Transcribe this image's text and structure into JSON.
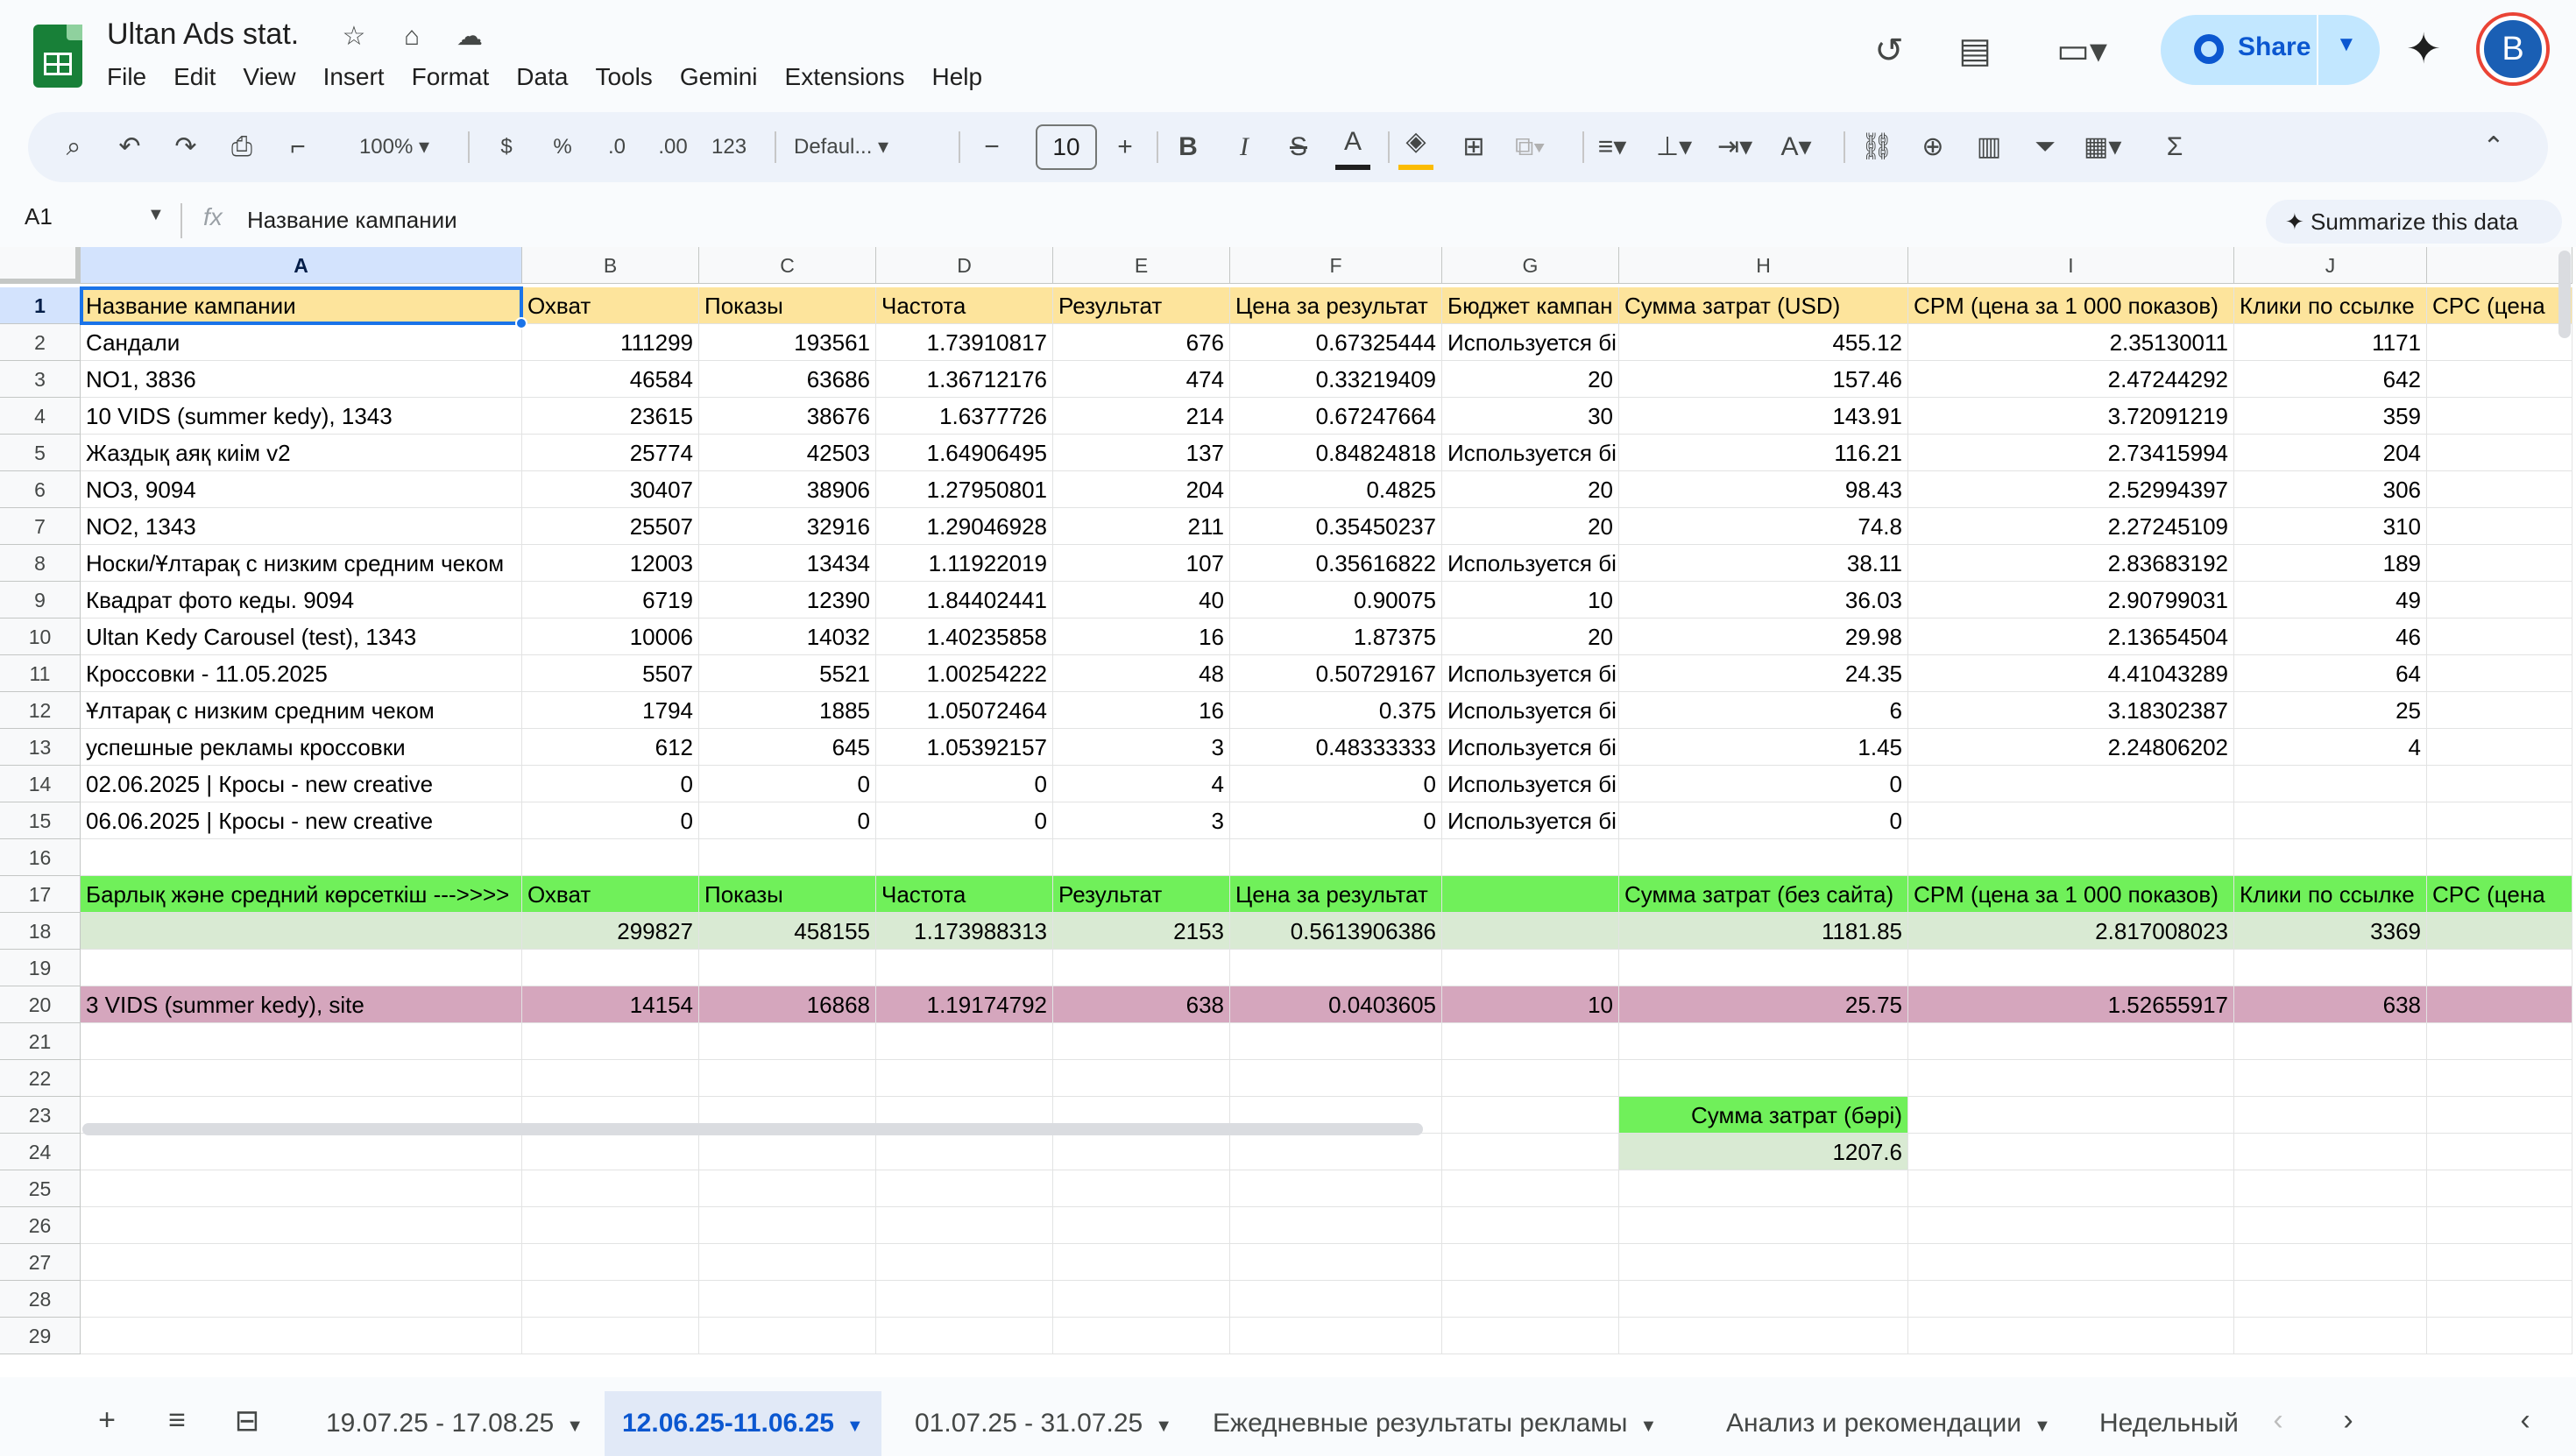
{
  "doc_title": "Ultan Ads stat.",
  "menu": [
    "File",
    "Edit",
    "View",
    "Insert",
    "Format",
    "Data",
    "Tools",
    "Gemini",
    "Extensions",
    "Help"
  ],
  "share_label": "Share",
  "avatar_letter": "B",
  "toolbar": {
    "zoom": "100%",
    "currency": "$",
    "percent": "%",
    "dec_decrease": ".0",
    "dec_increase": ".00",
    "num_format": "123",
    "font": "Defaul...",
    "font_size": "10"
  },
  "name_box": "A1",
  "formula": "Название кампании",
  "summarize_label": "Summarize this data",
  "columns": [
    "A",
    "B",
    "C",
    "D",
    "E",
    "F",
    "G",
    "H",
    "I",
    "J",
    ""
  ],
  "rows": [
    [
      "Название кампании",
      "Охват",
      "Показы",
      "Частота",
      "Результат",
      "Цена за результат",
      "Бюджет кампан",
      "Сумма затрат (USD)",
      "CPM (цена за 1 000 показов)",
      "Клики по ссылке",
      "CPC (цена"
    ],
    [
      "Сандали",
      "111299",
      "193561",
      "1.73910817",
      "676",
      "0.67325444",
      "Используется бі",
      "455.12",
      "2.35130011",
      "1171",
      ""
    ],
    [
      "NO1, 3836",
      "46584",
      "63686",
      "1.36712176",
      "474",
      "0.33219409",
      "20",
      "157.46",
      "2.47244292",
      "642",
      ""
    ],
    [
      "10 VIDS (summer kedy), 1343",
      "23615",
      "38676",
      "1.6377726",
      "214",
      "0.67247664",
      "30",
      "143.91",
      "3.72091219",
      "359",
      ""
    ],
    [
      "Жаздық аяқ киім v2",
      "25774",
      "42503",
      "1.64906495",
      "137",
      "0.84824818",
      "Используется бі",
      "116.21",
      "2.73415994",
      "204",
      ""
    ],
    [
      "NO3, 9094",
      "30407",
      "38906",
      "1.27950801",
      "204",
      "0.4825",
      "20",
      "98.43",
      "2.52994397",
      "306",
      ""
    ],
    [
      "NO2, 1343",
      "25507",
      "32916",
      "1.29046928",
      "211",
      "0.35450237",
      "20",
      "74.8",
      "2.27245109",
      "310",
      ""
    ],
    [
      "Носки/Ұлтарақ с низким средним чеком",
      "12003",
      "13434",
      "1.11922019",
      "107",
      "0.35616822",
      "Используется бі",
      "38.11",
      "2.83683192",
      "189",
      ""
    ],
    [
      "Квадрат фото кеды. 9094",
      "6719",
      "12390",
      "1.84402441",
      "40",
      "0.90075",
      "10",
      "36.03",
      "2.90799031",
      "49",
      ""
    ],
    [
      "Ultan Kedy Carousel (test), 1343",
      "10006",
      "14032",
      "1.40235858",
      "16",
      "1.87375",
      "20",
      "29.98",
      "2.13654504",
      "46",
      ""
    ],
    [
      "Кроссовки - 11.05.2025",
      "5507",
      "5521",
      "1.00254222",
      "48",
      "0.50729167",
      "Используется бі",
      "24.35",
      "4.41043289",
      "64",
      ""
    ],
    [
      "Ұлтарақ с низким средним чеком",
      "1794",
      "1885",
      "1.05072464",
      "16",
      "0.375",
      "Используется бі",
      "6",
      "3.18302387",
      "25",
      ""
    ],
    [
      "успешные рекламы кроссовки",
      "612",
      "645",
      "1.05392157",
      "3",
      "0.48333333",
      "Используется бі",
      "1.45",
      "2.24806202",
      "4",
      ""
    ],
    [
      "02.06.2025 | Кросы - new creative",
      "0",
      "0",
      "0",
      "4",
      "0",
      "Используется бі",
      "0",
      "",
      "",
      ""
    ],
    [
      "06.06.2025 | Кросы - new creative",
      "0",
      "0",
      "0",
      "3",
      "0",
      "Используется бі",
      "0",
      "",
      "",
      ""
    ],
    [
      "",
      "",
      "",
      "",
      "",
      "",
      "",
      "",
      "",
      "",
      ""
    ],
    [
      "Барлық және средний көрсеткіш --->>>>",
      "Охват",
      "Показы",
      "Частота",
      "Результат",
      "Цена за результат",
      "",
      "Сумма затрат (без сайта)",
      "CPM (цена за 1 000 показов)",
      "Клики по ссылке",
      "CPC (цена"
    ],
    [
      "",
      "299827",
      "458155",
      "1.173988313",
      "2153",
      "0.5613906386",
      "",
      "1181.85",
      "2.817008023",
      "3369",
      ""
    ],
    [
      "",
      "",
      "",
      "",
      "",
      "",
      "",
      "",
      "",
      "",
      ""
    ],
    [
      "3 VIDS (summer kedy), site",
      "14154",
      "16868",
      "1.19174792",
      "638",
      "0.0403605",
      "10",
      "25.75",
      "1.52655917",
      "638",
      ""
    ],
    [
      "",
      "",
      "",
      "",
      "",
      "",
      "",
      "",
      "",
      "",
      ""
    ],
    [
      "",
      "",
      "",
      "",
      "",
      "",
      "",
      "",
      "",
      "",
      ""
    ],
    [
      "",
      "",
      "",
      "",
      "",
      "",
      "",
      "Сумма затрат (бәрі)",
      "",
      "",
      ""
    ],
    [
      "",
      "",
      "",
      "",
      "",
      "",
      "",
      "1207.6",
      "",
      "",
      ""
    ],
    [
      "",
      "",
      "",
      "",
      "",
      "",
      "",
      "",
      "",
      "",
      ""
    ],
    [
      "",
      "",
      "",
      "",
      "",
      "",
      "",
      "",
      "",
      "",
      ""
    ],
    [
      "",
      "",
      "",
      "",
      "",
      "",
      "",
      "",
      "",
      "",
      ""
    ],
    [
      "",
      "",
      "",
      "",
      "",
      "",
      "",
      "",
      "",
      "",
      ""
    ],
    [
      "",
      "",
      "",
      "",
      "",
      "",
      "",
      "",
      "",
      "",
      ""
    ]
  ],
  "row_numbers": [
    "1",
    "2",
    "3",
    "4",
    "5",
    "6",
    "7",
    "8",
    "9",
    "10",
    "11",
    "12",
    "13",
    "14",
    "15",
    "16",
    "17",
    "18",
    "19",
    "20",
    "21",
    "22",
    "23",
    "24",
    "25",
    "26",
    "27",
    "28",
    "29"
  ],
  "sheet_tabs": [
    "19.07.25 - 17.08.25",
    "12.06.25-11.06.25",
    "01.07.25 - 31.07.25",
    "Ежедневные результаты рекламы",
    "Анализ и рекомендации",
    "Недельный"
  ],
  "active_tab_index": 1,
  "colors": {
    "header_yellow": "#fde49c",
    "summary_green": "#70f05a",
    "summary_light": "#d9ead3",
    "site_row_pink": "#d5a6bd",
    "accent_blue": "#0b57d0"
  }
}
